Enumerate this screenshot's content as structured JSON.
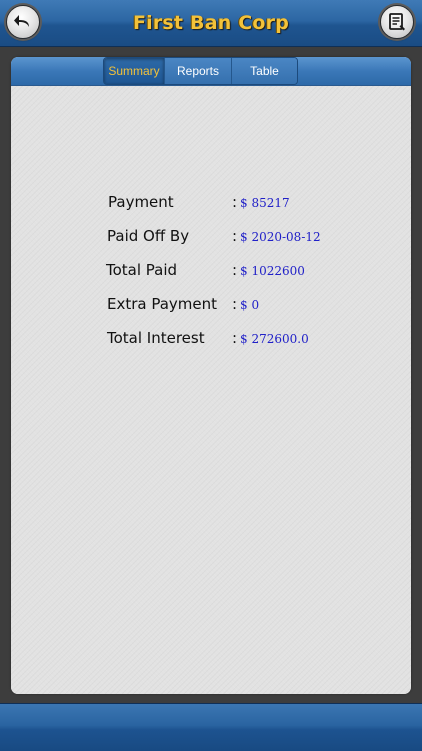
{
  "header": {
    "title": "First Ban Corp",
    "back_icon": "back-arrow-icon",
    "menu_icon": "document-list-icon"
  },
  "tabs": [
    {
      "label": "Summary",
      "selected": true
    },
    {
      "label": "Reports",
      "selected": false
    },
    {
      "label": "Table",
      "selected": false
    }
  ],
  "summary": {
    "colon": ":",
    "rows": [
      {
        "label": "Payment",
        "value": "$ 85217"
      },
      {
        "label": "Paid Off By",
        "value": "$ 2020-08-12"
      },
      {
        "label": "Total Paid",
        "value": "$ 1022600"
      },
      {
        "label": "Extra Payment",
        "value": "$ 0"
      },
      {
        "label": "Total Interest",
        "value": "$ 272600.0"
      }
    ]
  },
  "colors": {
    "title": "#f3c23a",
    "selected_tab_text": "#f3c23a",
    "value_text": "#2020c8",
    "bar_blue": "#2c66a3"
  }
}
